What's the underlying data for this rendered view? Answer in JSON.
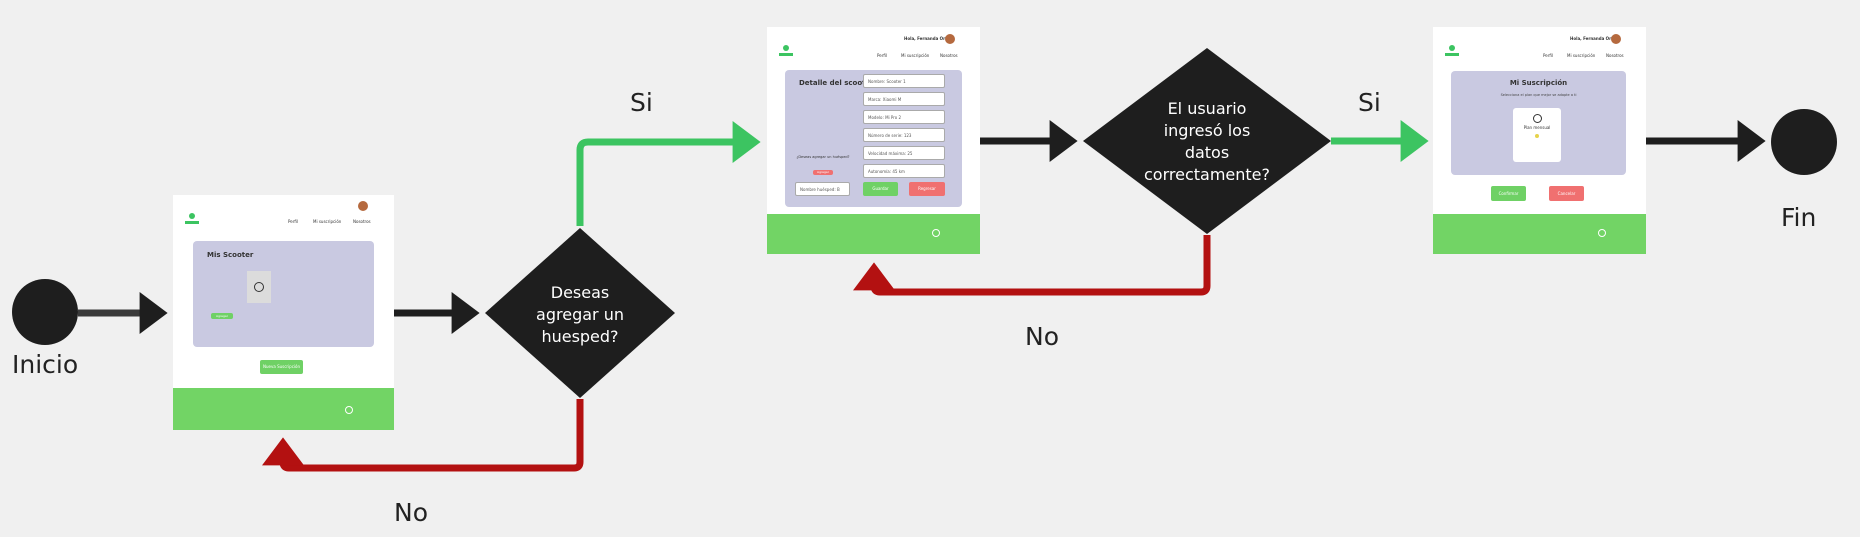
{
  "colors": {
    "background": "#f0f0f0",
    "node": "#1e1e1e",
    "arrow_default": "#1e1e1e",
    "arrow_yes": "#3cc461",
    "arrow_no": "#b31111",
    "panel": "#c9c9e1",
    "footer": "#72d465"
  },
  "labels": {
    "start": "Inicio",
    "end": "Fin",
    "yes1": "Si",
    "no1": "No",
    "yes2": "Si",
    "no2": "No"
  },
  "decisions": {
    "d1": [
      "Deseas",
      "agregar un",
      "huesped?"
    ],
    "d2": [
      "El usuario",
      "ingresó los",
      "datos",
      "correctamente?"
    ]
  },
  "screens": {
    "s1": {
      "title": "Mis Scooter",
      "nav": [
        "Perfil",
        "Mi suscripción",
        "Nosotros"
      ],
      "panel_button": "Agregar",
      "button": "Nueva Suscripción"
    },
    "s2": {
      "username": "Hola, Fernanda Ortiz",
      "nav": [
        "Perfil",
        "Mi suscripción",
        "Nosotros"
      ],
      "title": "Detalle del scooter",
      "fields": [
        "Nombre: Scooter 1",
        "Marca: Xiaomi M",
        "Modelo: Mi Pro 2",
        "Número de serie: 123",
        "Velocidad máxima: 25",
        "Autonomía: 45 km"
      ],
      "question": "¿Deseas agregar un huésped?",
      "add_button": "Agregar",
      "guest_field": "Nombre huésped: B",
      "save": "Guardar",
      "cancel": "Regresar"
    },
    "s3": {
      "username": "Hola, Fernanda Ortiz",
      "nav": [
        "Perfil",
        "Mi suscripción",
        "Nosotros"
      ],
      "title": "Mi Suscripción",
      "subtitle": "Selecciona el plan que mejor se adapte a ti",
      "plan": "Plan mensual",
      "confirm": "Confirmar",
      "cancel": "Cancelar"
    }
  }
}
